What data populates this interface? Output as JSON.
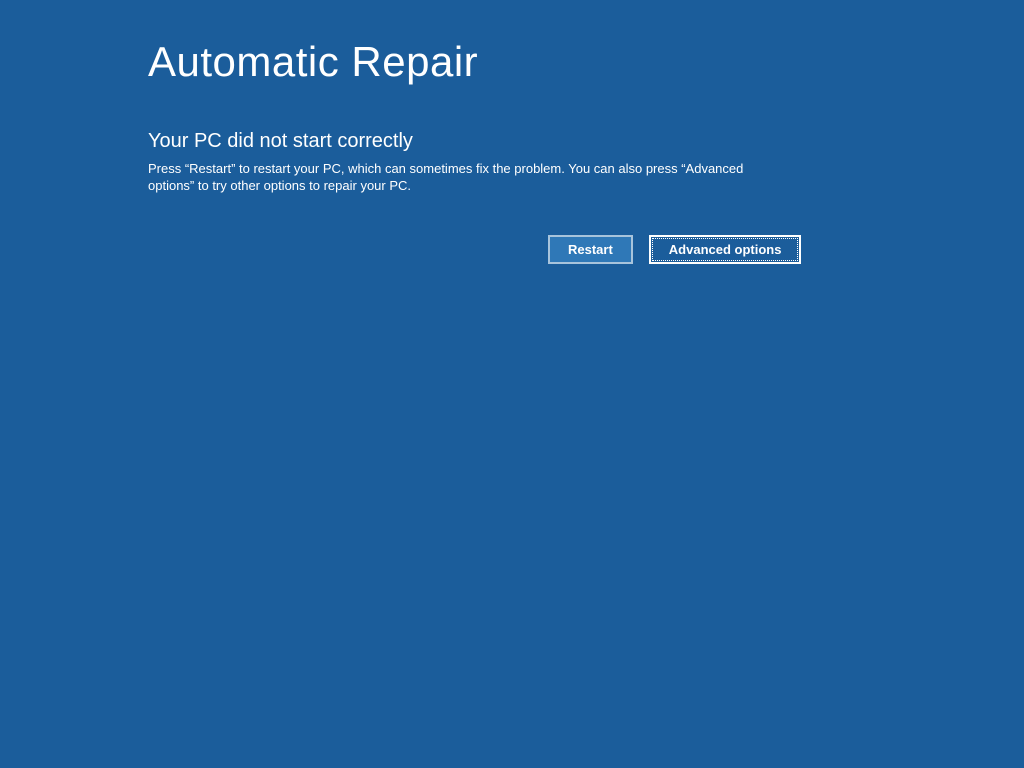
{
  "title": "Automatic Repair",
  "subtitle": "Your PC did not start correctly",
  "description": "Press “Restart” to restart your PC, which can sometimes fix the problem. You can also press “Advanced options” to try other options to repair your PC.",
  "buttons": {
    "restart": "Restart",
    "advanced": "Advanced options"
  }
}
